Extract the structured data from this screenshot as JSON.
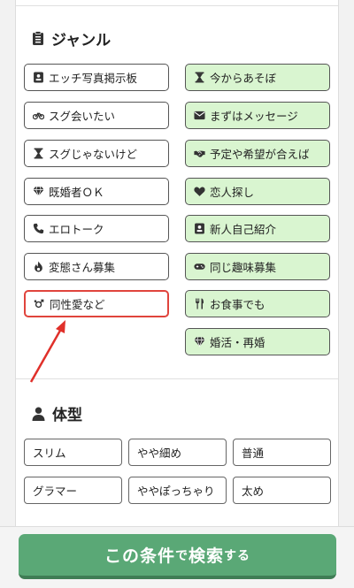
{
  "genre": {
    "title": "ジャンル",
    "left": [
      {
        "label": "エッチ写真掲示板",
        "icon": "id-card-icon"
      },
      {
        "label": "スグ会いたい",
        "icon": "motorcycle-icon"
      },
      {
        "label": "スグじゃないけど",
        "icon": "hourglass-icon"
      },
      {
        "label": "既婚者ＯＫ",
        "icon": "diamond-icon"
      },
      {
        "label": "エロトーク",
        "icon": "phone-icon"
      },
      {
        "label": "変態さん募集",
        "icon": "fire-icon"
      },
      {
        "label": "同性愛など",
        "icon": "gender-icon"
      }
    ],
    "right": [
      {
        "label": "今からあそぼ",
        "icon": "hourglass-icon"
      },
      {
        "label": "まずはメッセージ",
        "icon": "envelope-icon"
      },
      {
        "label": "予定や希望が合えば",
        "icon": "handshake-icon"
      },
      {
        "label": "恋人探し",
        "icon": "heart-icon"
      },
      {
        "label": "新人自己紹介",
        "icon": "id-card-icon"
      },
      {
        "label": "同じ趣味募集",
        "icon": "gamepad-icon"
      },
      {
        "label": "お食事でも",
        "icon": "utensils-icon"
      },
      {
        "label": "婚活・再婚",
        "icon": "diamond-icon"
      }
    ],
    "selected": "同性愛など"
  },
  "body_type": {
    "title": "体型",
    "options": [
      "スリム",
      "やや細め",
      "普通",
      "グラマー",
      "ややぽっちゃり",
      "太め"
    ]
  },
  "search_button": {
    "part1": "この条件",
    "part2": "で",
    "part3": "検索",
    "part4": "する"
  },
  "colors": {
    "accent_green": "#5aa876",
    "chip_green": "#d9f5d0",
    "selected_border": "#e0443c",
    "arrow": "#e0302a"
  }
}
